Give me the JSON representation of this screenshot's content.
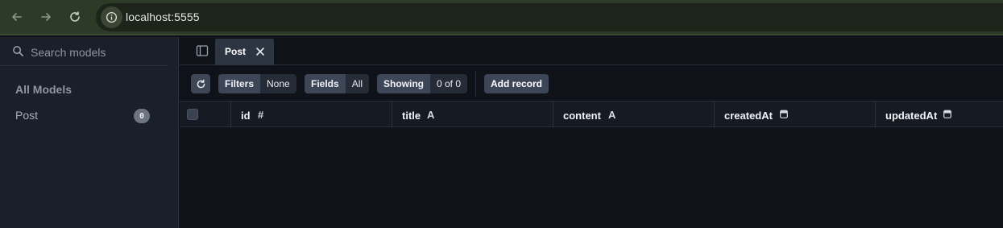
{
  "browser": {
    "url": "localhost:5555"
  },
  "sidebar": {
    "search_placeholder": "Search models",
    "section_title": "All Models",
    "models": [
      {
        "name": "Post",
        "count": "0"
      }
    ]
  },
  "tabs": [
    {
      "label": "Post"
    }
  ],
  "toolbar": {
    "filters_label": "Filters",
    "filters_value": "None",
    "fields_label": "Fields",
    "fields_value": "All",
    "showing_label": "Showing",
    "showing_value": "0 of 0",
    "add_record_label": "Add record"
  },
  "table": {
    "columns": [
      {
        "name": "id",
        "type_icon": "#"
      },
      {
        "name": "title",
        "type_icon": "A"
      },
      {
        "name": "content",
        "type_icon": "A"
      },
      {
        "name": "createdAt",
        "type_icon": "calendar-icon"
      },
      {
        "name": "updatedAt",
        "type_icon": "calendar-icon"
      }
    ],
    "rows": []
  },
  "colors": {
    "browser_bar": "#2d3a27",
    "sidebar_bg": "#1a1f29",
    "main_bg": "#0f1218",
    "button_bg": "#3d4656"
  }
}
